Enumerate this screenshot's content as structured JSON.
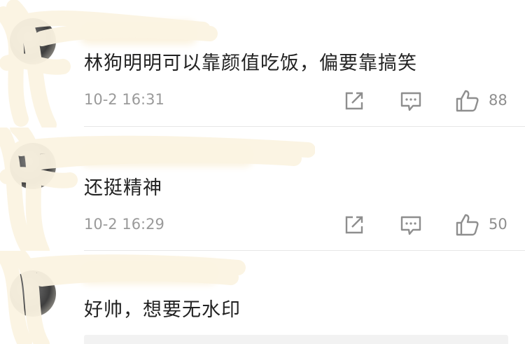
{
  "comments": [
    {
      "username": "",
      "text": "林狗明明可以靠颜值吃饭，偏要靠搞笑",
      "time": "10-2 16:31",
      "likes": "88"
    },
    {
      "username": "",
      "text": "还挺精神",
      "time": "10-2 16:29",
      "likes": "50"
    },
    {
      "username": "",
      "text": "好帅，想要无水印"
    }
  ],
  "icons": {
    "forward": "forward-icon",
    "reply": "reply-icon",
    "like": "thumbs-up-icon"
  },
  "colors": {
    "text": "#222222",
    "meta": "#9a9a9a",
    "icon": "#8e8e8e",
    "redaction": "#fbf3e1"
  }
}
